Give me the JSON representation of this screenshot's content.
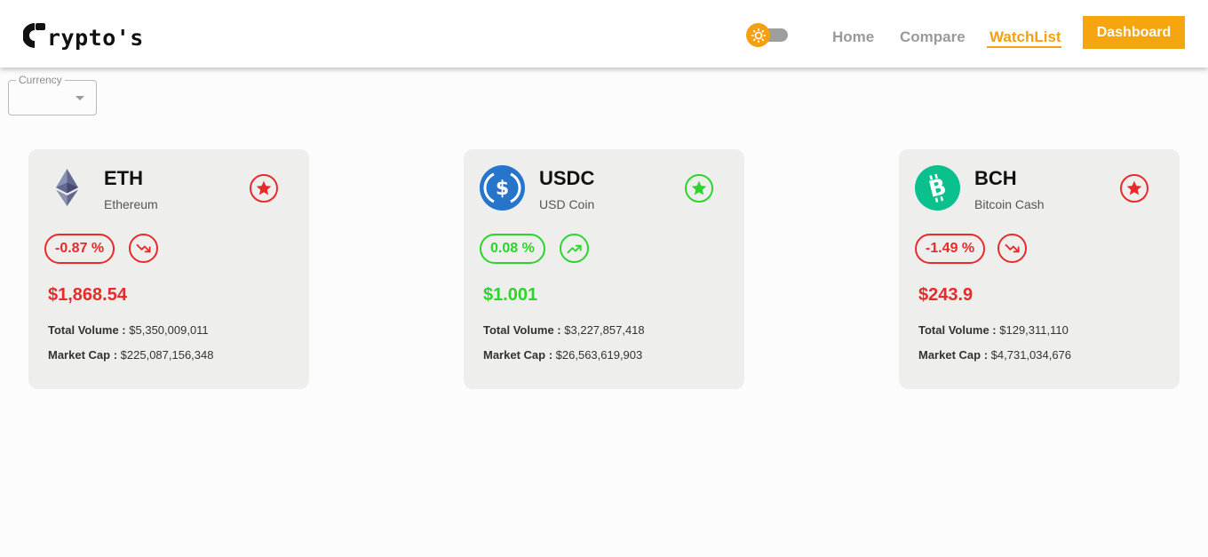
{
  "header": {
    "logo_text": "rypto's",
    "nav": {
      "home": "Home",
      "compare": "Compare",
      "watchlist": "WatchList",
      "dashboard": "Dashboard"
    },
    "theme_icon": "sun-icon"
  },
  "currency_select": {
    "label": "Currency",
    "value": ""
  },
  "colors": {
    "accent": "#f4a012",
    "negative": "#e82a2a",
    "positive": "#2bd52b",
    "card_bg": "#eeeeed"
  },
  "coins": [
    {
      "symbol": "ETH",
      "name": "Ethereum",
      "change": "-0.87 %",
      "trend": "down",
      "price": "$1,868.54",
      "volume_label": "Total Volume :",
      "volume": "$5,350,009,011",
      "cap_label": "Market Cap :",
      "cap": "$225,087,156,348",
      "icon": "ethereum-icon"
    },
    {
      "symbol": "USDC",
      "name": "USD Coin",
      "change": "0.08 %",
      "trend": "up",
      "price": "$1.001",
      "volume_label": "Total Volume :",
      "volume": "$3,227,857,418",
      "cap_label": "Market Cap :",
      "cap": "$26,563,619,903",
      "icon": "usd-coin-icon"
    },
    {
      "symbol": "BCH",
      "name": "Bitcoin Cash",
      "change": "-1.49 %",
      "trend": "down",
      "price": "$243.9",
      "volume_label": "Total Volume :",
      "volume": "$129,311,110",
      "cap_label": "Market Cap :",
      "cap": "$4,731,034,676",
      "icon": "bitcoin-cash-icon"
    }
  ]
}
